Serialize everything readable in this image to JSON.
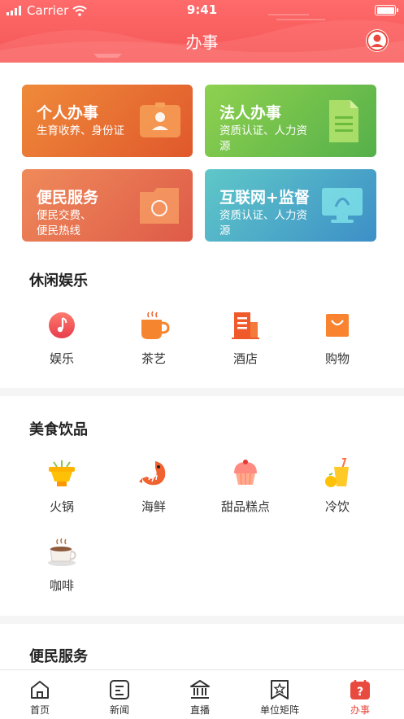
{
  "status_bar": {
    "carrier": "Carrier",
    "time": "9:41"
  },
  "header": {
    "title": "办事"
  },
  "cards": [
    {
      "title": "个人办事",
      "subtitle": "生育收养、身份证",
      "icon": "id-card-icon"
    },
    {
      "title": "法人办事",
      "subtitle": "资质认证、人力资源",
      "icon": "document-icon"
    },
    {
      "title": "便民服务",
      "subtitle": "便民交费、便民热线",
      "icon": "folder-compass-icon"
    },
    {
      "title": "互联网+监督",
      "subtitle": "资质认证、人力资源",
      "icon": "monitor-icon"
    }
  ],
  "sections": [
    {
      "title": "休闲娱乐",
      "items": [
        {
          "label": "娱乐",
          "icon": "music-icon"
        },
        {
          "label": "茶艺",
          "icon": "tea-cup-icon"
        },
        {
          "label": "酒店",
          "icon": "hotel-icon"
        },
        {
          "label": "购物",
          "icon": "shopping-bag-icon"
        }
      ]
    },
    {
      "title": "美食饮品",
      "items": [
        {
          "label": "火锅",
          "icon": "hotpot-icon"
        },
        {
          "label": "海鲜",
          "icon": "shrimp-icon"
        },
        {
          "label": "甜品糕点",
          "icon": "cupcake-icon"
        },
        {
          "label": "冷饮",
          "icon": "cold-drink-icon"
        },
        {
          "label": "咖啡",
          "icon": "coffee-icon"
        }
      ]
    },
    {
      "title": "便民服务",
      "items": []
    }
  ],
  "tabbar": {
    "items": [
      {
        "label": "首页",
        "icon": "home-icon"
      },
      {
        "label": "新闻",
        "icon": "news-icon"
      },
      {
        "label": "直播",
        "icon": "live-icon"
      },
      {
        "label": "单位矩阵",
        "icon": "matrix-icon"
      },
      {
        "label": "办事",
        "icon": "service-icon",
        "active": true
      }
    ]
  },
  "colors": {
    "header": "#f35656",
    "accent": "#e84a3f"
  }
}
